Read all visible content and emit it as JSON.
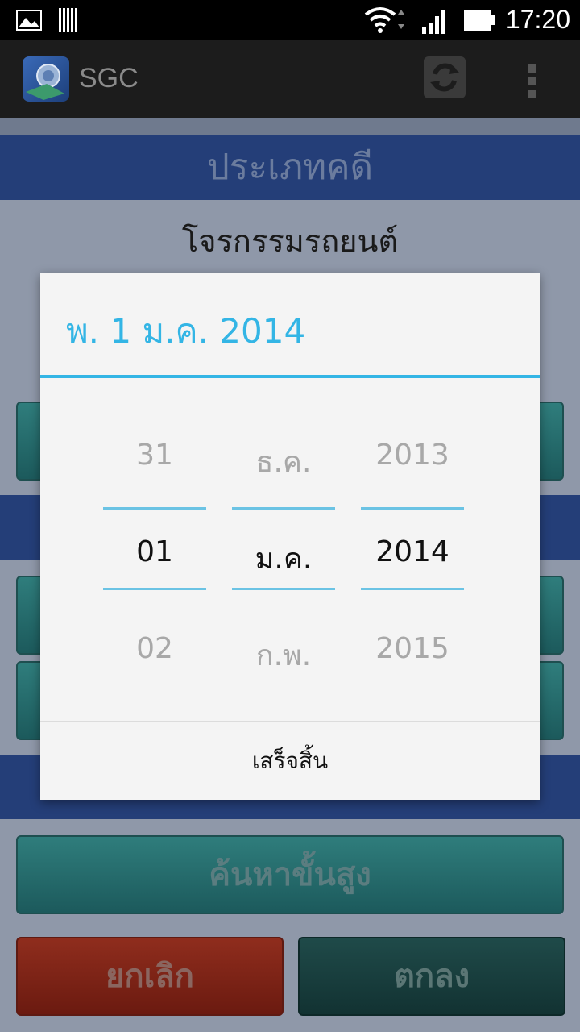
{
  "status_bar": {
    "time": "17:20"
  },
  "action_bar": {
    "title": "SGC"
  },
  "background": {
    "section_header_1": "ประเภทคดี",
    "case_type_value": "โจรกรรมรถยนต์",
    "advanced_search_label": "ค้นหาขั้นสูง",
    "cancel_label": "ยกเลิก",
    "ok_label": "ตกลง"
  },
  "date_dialog": {
    "title": "พ. 1 ม.ค. 2014",
    "day": {
      "prev": "31",
      "current": "01",
      "next": "02"
    },
    "month": {
      "prev": "ธ.ค.",
      "current": "ม.ค.",
      "next": "ก.พ."
    },
    "year": {
      "prev": "2013",
      "current": "2014",
      "next": "2015"
    },
    "done_label": "เสร็จสิ้น"
  },
  "colors": {
    "accent": "#33b5e5",
    "header_blue": "#243e78",
    "teal_button": "#2f7d7c",
    "cancel_red": "#8f2d1d"
  }
}
